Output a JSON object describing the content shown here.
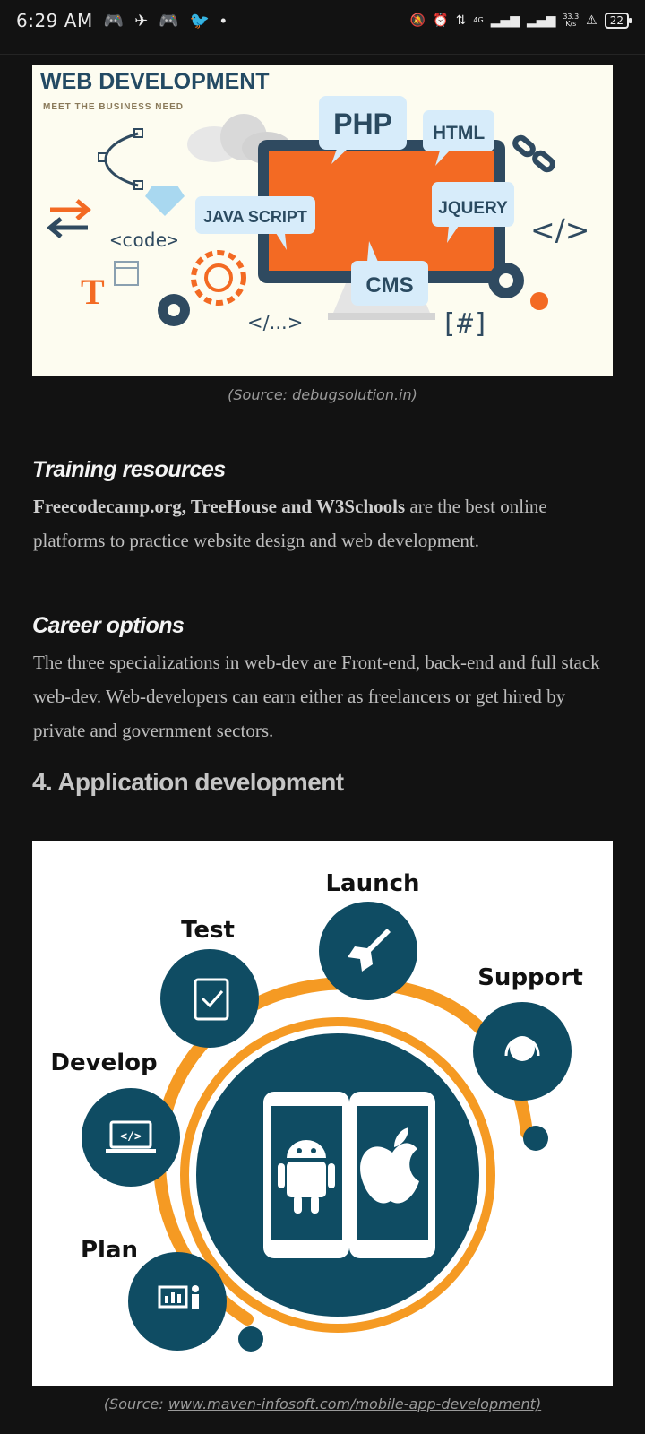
{
  "status_bar": {
    "time": "6:29 AM",
    "network_type": "4G",
    "speed_value": "33.3",
    "speed_unit": "K/s",
    "battery": "22"
  },
  "figure1": {
    "title": "WEB DEVELOPMENT",
    "subtitle": "MEET THE BUSINESS NEED",
    "labels": {
      "php": "PHP",
      "html": "HTML",
      "jquery": "JQUERY",
      "javascript": "JAVA SCRIPT",
      "cms": "CMS",
      "code": "<code>",
      "tag": "</>",
      "ellipsis_tag": "</...>",
      "hash": "[#]",
      "t": "T"
    },
    "caption": "(Source: debugsolution.in)"
  },
  "training": {
    "heading": "Training resources",
    "bold_text": "Freecodecamp.org, TreeHouse and W3Schools",
    "text": " are the best online platforms to practice website design and web development."
  },
  "career": {
    "heading": "Career options",
    "text": "The three specializations in web-dev are Front-end, back-end and full stack web-dev. Web-developers can earn either as freelancers or get hired by private and government sectors."
  },
  "section4": {
    "heading": "4. Application development"
  },
  "figure2": {
    "labels": {
      "launch": "Launch",
      "test": "Test",
      "support": "Support",
      "develop": "Develop",
      "plan": "Plan",
      "code_icon": "</>"
    },
    "caption_prefix": "(Source: ",
    "caption_link": "www.maven-infosoft.com/mobile-app-development)"
  }
}
